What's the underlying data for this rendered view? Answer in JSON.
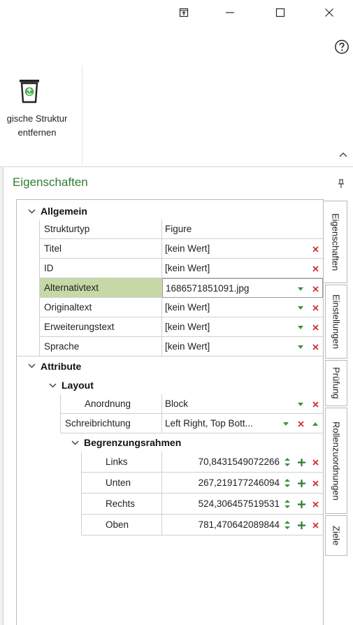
{
  "window": {
    "controls": {
      "restore_icon": "restore-ribbon-icon",
      "minimize_icon": "minimize-icon",
      "maximize_icon": "maximize-icon",
      "close_icon": "close-icon"
    },
    "help_icon": "help-icon"
  },
  "ribbon": {
    "remove_button": {
      "icon": "recycle-bin-icon",
      "label_line1": "gische Struktur",
      "label_line2": "entfernen"
    },
    "collapse_icon": "chevron-up-icon"
  },
  "panel": {
    "title": "Eigenschaften",
    "pin_icon": "pin-icon",
    "accent_color": "#2f7d32",
    "selection_color": "#c6d8a6"
  },
  "properties": {
    "group_general": "Allgemein",
    "rows_general": [
      {
        "name": "Strukturtyp",
        "value": "Figure"
      },
      {
        "name": "Titel",
        "value": "[kein Wert]"
      },
      {
        "name": "ID",
        "value": "[kein Wert]"
      },
      {
        "name": "Alternativtext",
        "value": "1686571851091.jpg"
      },
      {
        "name": "Originaltext",
        "value": "[kein Wert]"
      },
      {
        "name": "Erweiterungstext",
        "value": "[kein Wert]"
      },
      {
        "name": "Sprache",
        "value": "[kein Wert]"
      }
    ],
    "group_attributes": "Attribute",
    "group_layout": "Layout",
    "rows_layout": [
      {
        "name": "Anordnung",
        "value": "Block"
      },
      {
        "name": "Schreibrichtung",
        "value": "Left Right, Top Bott..."
      }
    ],
    "group_bbox": "Begrenzungsrahmen",
    "rows_bbox": [
      {
        "name": "Links",
        "value": "70,8431549072266"
      },
      {
        "name": "Unten",
        "value": "267,219177246094"
      },
      {
        "name": "Rechts",
        "value": "524,306457519531"
      },
      {
        "name": "Oben",
        "value": "781,470642089844"
      }
    ]
  },
  "tabs": [
    "Eigenschaften",
    "Einstellungen",
    "Prüfung",
    "Rollenzuordnungen",
    "Ziele"
  ]
}
